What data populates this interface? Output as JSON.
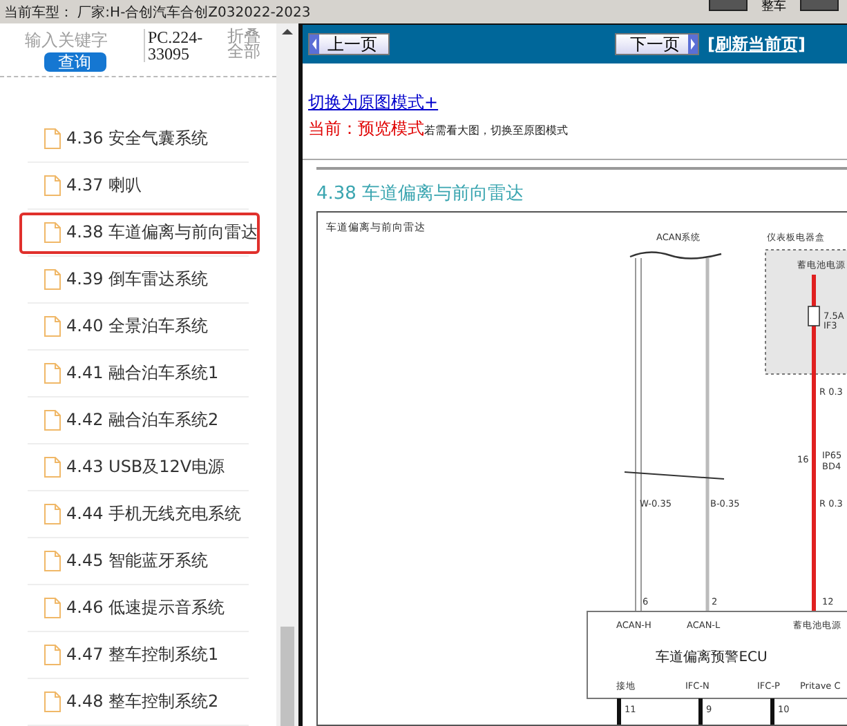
{
  "top_bar": {
    "title": "当前车型：  厂家:H-合创汽车合创Z032022-2023",
    "buttons": [
      "整车"
    ]
  },
  "sidebar": {
    "search": {
      "placeholder": "输入关键字"
    },
    "search_button": "查询",
    "code": "PC.224-33095",
    "collapse_link": "折叠全部",
    "items": [
      {
        "label": "4.36 安全气囊系统",
        "selected": false
      },
      {
        "label": "4.37 喇叭",
        "selected": false
      },
      {
        "label": "4.38 车道偏离与前向雷达",
        "selected": true
      },
      {
        "label": "4.39 倒车雷达系统",
        "selected": false
      },
      {
        "label": "4.40 全景泊车系统",
        "selected": false
      },
      {
        "label": "4.41 融合泊车系统1",
        "selected": false
      },
      {
        "label": "4.42 融合泊车系统2",
        "selected": false
      },
      {
        "label": "4.43 USB及12V电源",
        "selected": false
      },
      {
        "label": "4.44 手机无线充电系统",
        "selected": false
      },
      {
        "label": "4.45 智能蓝牙系统",
        "selected": false
      },
      {
        "label": "4.46 低速提示音系统",
        "selected": false
      },
      {
        "label": "4.47 整车控制系统1",
        "selected": false
      },
      {
        "label": "4.48 整车控制系统2",
        "selected": false
      }
    ]
  },
  "toolbar": {
    "prev_button": "上一页",
    "next_button": "下一页",
    "refresh_link": "[刷新当前页]"
  },
  "content": {
    "mode_link": "切换为原图模式+",
    "mode_status": "当前：预览模式",
    "mode_hint": "若需看大图，切换至原图模式",
    "heading": "4.38 车道偏离与前向雷达",
    "diagram": {
      "title": "车道偏离与前向雷达",
      "ecu": "车道偏离预警ECU",
      "labels": [
        "ACAN系统",
        "仪表板电器盒",
        "蓄电池电源",
        "7.5A",
        "IF3",
        "R 0.3",
        "16",
        "IP65",
        "BD4",
        "W-0.35",
        "B-0.35",
        "R 0.3",
        "6",
        "2",
        "12",
        "ACAN-H",
        "ACAN-L",
        "蓄电池电源",
        "接地",
        "IFC-N",
        "IFC-P",
        "Pritave C",
        "11",
        "9",
        "10"
      ]
    }
  }
}
